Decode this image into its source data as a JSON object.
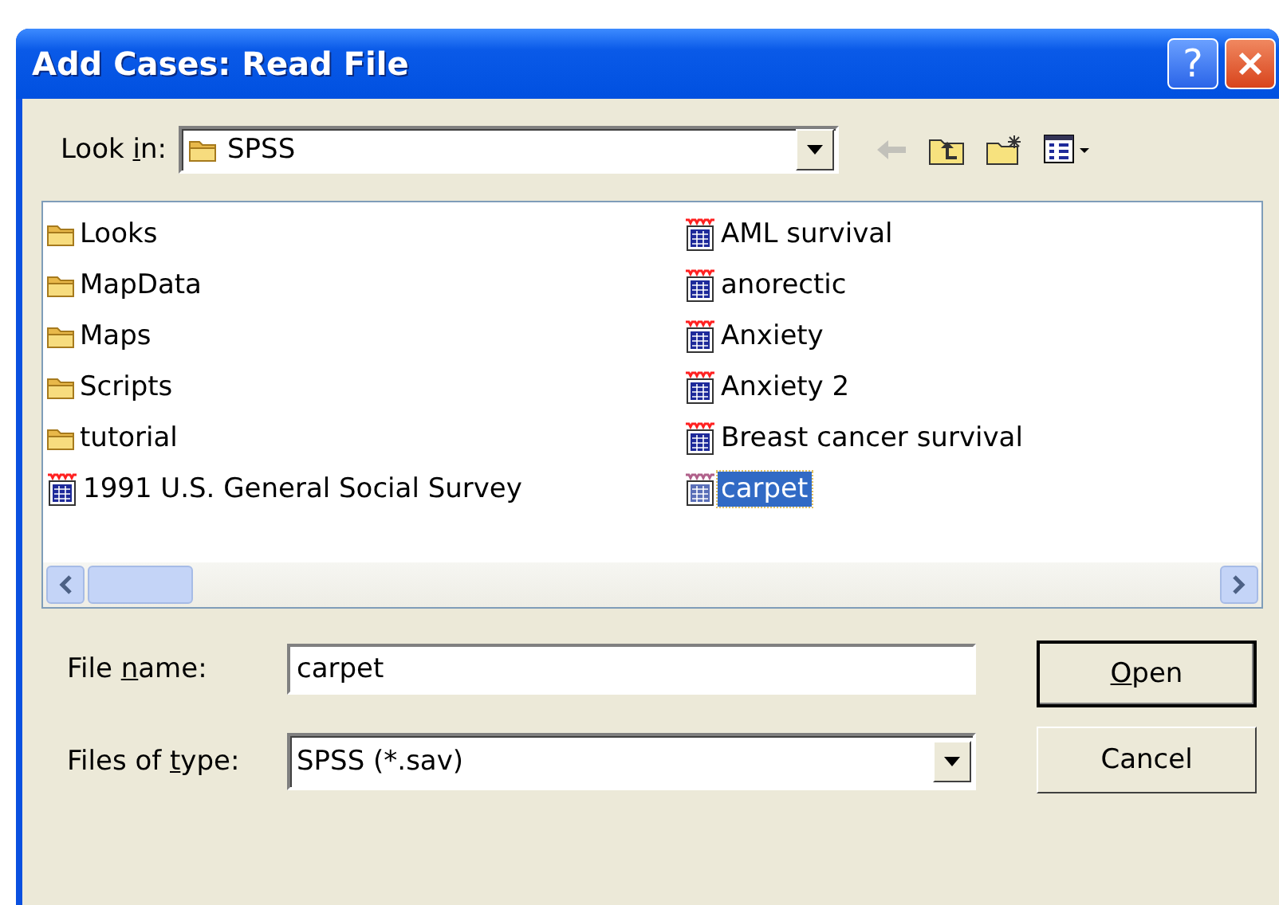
{
  "window": {
    "title": "Add Cases: Read File",
    "buttons": [
      {
        "kind": "help",
        "label": "?"
      },
      {
        "kind": "close"
      }
    ]
  },
  "look_in": {
    "label": {
      "before": "Look ",
      "key": "i",
      "after": "n:"
    },
    "value": "SPSS"
  },
  "toolbar": [
    {
      "kind": "back",
      "disabled": true
    },
    {
      "kind": "up",
      "disabled": false
    },
    {
      "kind": "new-folder",
      "disabled": false
    },
    {
      "kind": "view",
      "disabled": false
    }
  ],
  "files": [
    {
      "name": "Looks",
      "kind": "folder",
      "selected": false
    },
    {
      "name": "MapData",
      "kind": "folder",
      "selected": false
    },
    {
      "name": "Maps",
      "kind": "folder",
      "selected": false
    },
    {
      "name": "Scripts",
      "kind": "folder",
      "selected": false
    },
    {
      "name": "tutorial",
      "kind": "folder",
      "selected": false
    },
    {
      "name": "1991 U.S. General Social Survey",
      "kind": "data",
      "selected": false
    },
    {
      "name": "AML survival",
      "kind": "data",
      "selected": false
    },
    {
      "name": "anorectic",
      "kind": "data",
      "selected": false
    },
    {
      "name": "Anxiety",
      "kind": "data",
      "selected": false
    },
    {
      "name": "Anxiety 2",
      "kind": "data",
      "selected": false
    },
    {
      "name": "Breast cancer survival",
      "kind": "data",
      "selected": false
    },
    {
      "name": "carpet",
      "kind": "data",
      "selected": true
    }
  ],
  "file_name": {
    "label": {
      "before": "File ",
      "key": "n",
      "after": "ame:"
    },
    "value": "carpet"
  },
  "file_type": {
    "label": {
      "before": "Files of ",
      "key": "t",
      "after": "ype:"
    },
    "value": "SPSS (*.sav)"
  },
  "buttons": [
    {
      "label": {
        "key": "O",
        "after": "pen"
      },
      "default": true
    },
    {
      "label": {
        "before": "Cancel"
      },
      "default": false
    }
  ]
}
